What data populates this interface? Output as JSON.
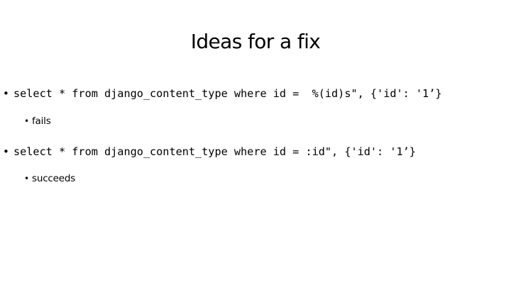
{
  "slide": {
    "title": "Ideas for a fix",
    "bullets": [
      {
        "text": "select * from django_content_type where id =  %(id)s\", {'id': '1’}",
        "sub": "fails"
      },
      {
        "text": "select * from django_content_type where id = :id\", {'id': '1’}",
        "sub": "succeeds"
      }
    ],
    "bullet_glyph": "•"
  }
}
